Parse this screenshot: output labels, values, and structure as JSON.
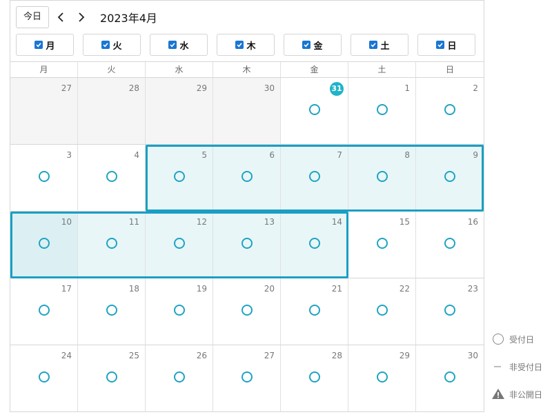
{
  "toolbar": {
    "today_label": "今日",
    "prev_icon": "chevron-left-icon",
    "next_icon": "chevron-right-icon",
    "month_title": "2023年4月"
  },
  "filters": [
    {
      "label": "月",
      "checked": true
    },
    {
      "label": "火",
      "checked": true
    },
    {
      "label": "水",
      "checked": true
    },
    {
      "label": "木",
      "checked": true
    },
    {
      "label": "金",
      "checked": true
    },
    {
      "label": "土",
      "checked": true
    },
    {
      "label": "日",
      "checked": true
    }
  ],
  "weekdays": [
    "月",
    "火",
    "水",
    "木",
    "金",
    "土",
    "日"
  ],
  "weeks": [
    [
      {
        "day": "27",
        "out": true
      },
      {
        "day": "28",
        "out": true
      },
      {
        "day": "29",
        "out": true
      },
      {
        "day": "30",
        "out": true
      },
      {
        "day": "31",
        "today": true,
        "mark": true
      },
      {
        "day": "1",
        "mark": true
      },
      {
        "day": "2",
        "mark": true
      }
    ],
    [
      {
        "day": "3",
        "mark": true
      },
      {
        "day": "4",
        "mark": true
      },
      {
        "day": "5",
        "mark": true,
        "sel": true
      },
      {
        "day": "6",
        "mark": true,
        "sel": true
      },
      {
        "day": "7",
        "mark": true,
        "sel": true
      },
      {
        "day": "8",
        "mark": true,
        "sel": true
      },
      {
        "day": "9",
        "mark": true,
        "sel": true
      }
    ],
    [
      {
        "day": "10",
        "mark": true,
        "sel": true,
        "first": true
      },
      {
        "day": "11",
        "mark": true,
        "sel": true
      },
      {
        "day": "12",
        "mark": true,
        "sel": true
      },
      {
        "day": "13",
        "mark": true,
        "sel": true
      },
      {
        "day": "14",
        "mark": true,
        "sel": true
      },
      {
        "day": "15",
        "mark": true
      },
      {
        "day": "16",
        "mark": true
      }
    ],
    [
      {
        "day": "17",
        "mark": true
      },
      {
        "day": "18",
        "mark": true
      },
      {
        "day": "19",
        "mark": true
      },
      {
        "day": "20",
        "mark": true
      },
      {
        "day": "21",
        "mark": true
      },
      {
        "day": "22",
        "mark": true
      },
      {
        "day": "23",
        "mark": true
      }
    ],
    [
      {
        "day": "24",
        "mark": true
      },
      {
        "day": "25",
        "mark": true
      },
      {
        "day": "26",
        "mark": true
      },
      {
        "day": "27",
        "mark": true
      },
      {
        "day": "28",
        "mark": true
      },
      {
        "day": "29",
        "mark": true
      },
      {
        "day": "30",
        "mark": true
      }
    ]
  ],
  "legend": [
    {
      "icon": "circle-icon",
      "label": "受付日"
    },
    {
      "icon": "dash-icon",
      "label": "非受付日"
    },
    {
      "icon": "warning-icon",
      "label": "非公開日"
    }
  ],
  "colors": {
    "accent": "#1fa3c2",
    "today_badge": "#1fb4c9",
    "selection_border": "#1a9fc4",
    "selection_fill": "#e8f6f8",
    "checkbox": "#1976d2"
  }
}
